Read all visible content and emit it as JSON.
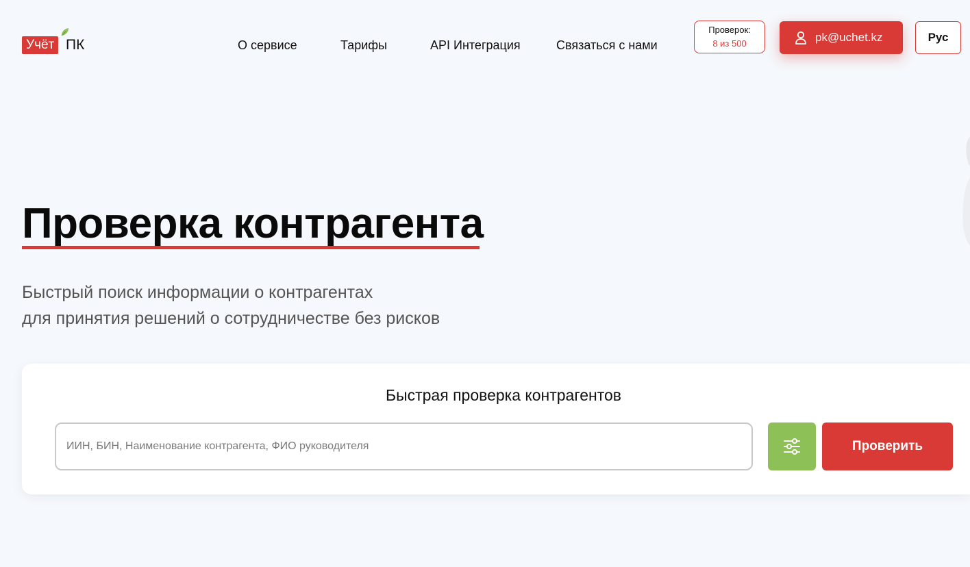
{
  "brand": {
    "logo_box_text": "Учёт",
    "logo_suffix": "ПК",
    "colors": {
      "accent": "#d93a35",
      "green": "#8dc056",
      "background": "#f5f8fc"
    }
  },
  "nav": {
    "items": [
      {
        "label": "О сервисе"
      },
      {
        "label": "Тарифы"
      },
      {
        "label": "API Интеграция"
      },
      {
        "label": "Связаться с нами"
      }
    ]
  },
  "checks": {
    "label": "Проверок:",
    "count": "8 из 500",
    "used": 8,
    "total": 500
  },
  "user": {
    "email": "pk@uchet.kz",
    "icon": "user-icon"
  },
  "language": {
    "selected": "Рус"
  },
  "hero": {
    "title": "Проверка контрагента",
    "subtitle_line1": "Быстрый поиск информации о контрагентах",
    "subtitle_line2": "для принятия решений о сотрудничестве без рисков"
  },
  "search": {
    "title": "Быстрая проверка контрагентов",
    "placeholder": "ИИН, БИН, Наименование контрагента, ФИО руководителя",
    "value": "",
    "filter_icon": "sliders-icon",
    "submit_label": "Проверить"
  }
}
